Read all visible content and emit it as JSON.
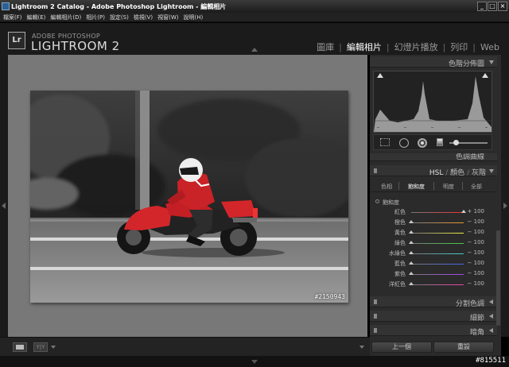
{
  "window": {
    "title": "Lightroom 2 Catalog - Adobe Photoshop Lightroom - 編輯相片",
    "minimize": "_",
    "maximize": "□",
    "close": "×"
  },
  "menu": [
    "檔案(F)",
    "編輯(E)",
    "編輯相片(D)",
    "相片(P)",
    "設定(S)",
    "檢視(V)",
    "視窗(W)",
    "說明(H)"
  ],
  "identity": {
    "logo": "Lr",
    "small": "ADOBE PHOTOSHOP",
    "big": "LIGHTROOM 2"
  },
  "modules": [
    {
      "label": "圖庫",
      "active": false
    },
    {
      "label": "編輯相片",
      "active": true
    },
    {
      "label": "幻燈片播放",
      "active": false
    },
    {
      "label": "列印",
      "active": false
    },
    {
      "label": "Web",
      "active": false
    }
  ],
  "photo": {
    "watermark": "#2150943"
  },
  "panel": {
    "histogram_label": "色階分佈圖",
    "tone_curve_label": "色調曲線",
    "hsl_tabs": {
      "hsl": "HSL",
      "color": "顏色",
      "grayscale": "灰階",
      "sep": "/"
    },
    "hsl_subtabs": [
      "色相",
      "飽和度",
      "明度",
      "全部"
    ],
    "hsl_subtab_active": 1,
    "saturation_title": "飽和度",
    "saturation": [
      {
        "label": "紅色",
        "value": "+ 100",
        "amount": 100
      },
      {
        "label": "橙色",
        "value": "− 100",
        "amount": -100
      },
      {
        "label": "黃色",
        "value": "− 100",
        "amount": -100
      },
      {
        "label": "綠色",
        "value": "− 100",
        "amount": -100
      },
      {
        "label": "水綠色",
        "value": "− 100",
        "amount": -100
      },
      {
        "label": "藍色",
        "value": "− 100",
        "amount": -100
      },
      {
        "label": "紫色",
        "value": "− 100",
        "amount": -100
      },
      {
        "label": "洋紅色",
        "value": "− 100",
        "amount": -100
      }
    ],
    "split_toning_label": "分割色調",
    "detail_label": "細節",
    "vignette_label": "暗角",
    "prev_button": "上一個",
    "reset_button": "重設"
  },
  "toolbar": {
    "compare": "Y|Y"
  },
  "footer": {
    "id": "#815511"
  },
  "colors": {
    "accent_red": "#d3262a",
    "panel_bg": "#2b2b2b",
    "canvas_bg": "#787878"
  }
}
